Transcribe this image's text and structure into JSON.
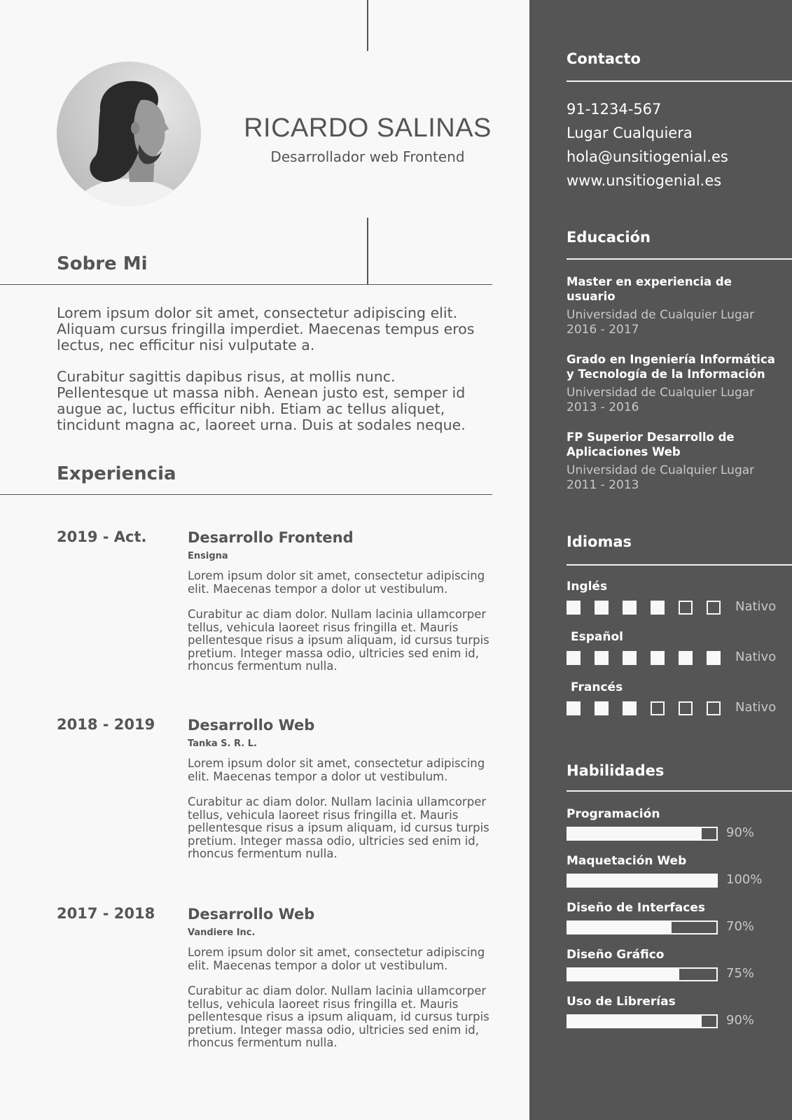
{
  "header": {
    "name": "RICARDO SALINAS",
    "role": "Desarrollador web Frontend"
  },
  "about": {
    "title": "Sobre Mi",
    "paragraphs": [
      "Lorem ipsum dolor sit amet, consectetur adipiscing elit. Aliquam cursus fringilla imperdiet. Maecenas tempus eros lectus, nec efficitur nisi vulputate a.",
      "Curabitur sagittis dapibus risus, at mollis nunc. Pellentesque ut massa nibh. Aenean justo est, semper id augue ac, luctus efficitur nibh. Etiam ac tellus aliquet, tincidunt magna ac, laoreet urna. Duis at sodales neque."
    ]
  },
  "experience": {
    "title": "Experiencia",
    "items": [
      {
        "date": "2019 - Act.",
        "title": "Desarrollo Frontend",
        "company": "Ensigna",
        "text1": "Lorem ipsum dolor sit amet, consectetur adipiscing elit. Maecenas tempor a dolor ut vestibulum.",
        "text2": "Curabitur ac diam dolor. Nullam lacinia ullamcorper tellus, vehicula laoreet risus fringilla et. Mauris pellentesque risus a ipsum aliquam, id cursus turpis pretium. Integer massa odio, ultricies sed enim id, rhoncus fermentum nulla."
      },
      {
        "date": "2018 - 2019",
        "title": "Desarrollo Web",
        "company": "Tanka S. R. L.",
        "text1": "Lorem ipsum dolor sit amet, consectetur adipiscing elit. Maecenas tempor a dolor ut vestibulum.",
        "text2": "Curabitur ac diam dolor. Nullam lacinia ullamcorper tellus, vehicula laoreet risus fringilla et. Mauris pellentesque risus a ipsum aliquam, id cursus turpis pretium. Integer massa odio, ultricies sed enim id, rhoncus fermentum nulla."
      },
      {
        "date": "2017 - 2018",
        "title": "Desarrollo Web",
        "company": "Vandiere Inc.",
        "text1": "Lorem ipsum dolor sit amet, consectetur adipiscing elit. Maecenas tempor a dolor ut vestibulum.",
        "text2": "Curabitur ac diam dolor. Nullam lacinia ullamcorper tellus, vehicula laoreet risus fringilla et. Mauris pellentesque risus a ipsum aliquam, id cursus turpis pretium. Integer massa odio, ultricies sed enim id, rhoncus fermentum nulla."
      }
    ]
  },
  "contact": {
    "title": "Contacto",
    "phone": "91-1234-567",
    "location": "Lugar Cualquiera",
    "email": "hola@unsitiogenial.es",
    "website": "www.unsitiogenial.es"
  },
  "education": {
    "title": "Educación",
    "items": [
      {
        "degree": "Master en experiencia de usuario",
        "school": "Universidad de Cualquier Lugar",
        "years": "2016 - 2017"
      },
      {
        "degree": "Grado en Ingeniería Informática y Tecnología de la Información",
        "school": "Universidad de Cualquier Lugar",
        "years": "2013 - 2016"
      },
      {
        "degree": "FP Superior Desarrollo de Aplicaciones Web",
        "school": "Universidad de Cualquier Lugar",
        "years": "2011 - 2013"
      }
    ]
  },
  "languages": {
    "title": "Idiomas",
    "max_level": 6,
    "items": [
      {
        "name": "Inglés",
        "level": 4,
        "label": "Nativo"
      },
      {
        "name": "Español",
        "level": 6,
        "label": "Nativo"
      },
      {
        "name": "Francés",
        "level": 3,
        "label": "Nativo"
      }
    ]
  },
  "skills": {
    "title": "Habilidades",
    "items": [
      {
        "name": "Programación",
        "percent": 90,
        "label": "90%"
      },
      {
        "name": "Maquetación Web",
        "percent": 100,
        "label": "100%"
      },
      {
        "name": "Diseño de Interfaces",
        "percent": 70,
        "label": "70%"
      },
      {
        "name": "Diseño Gráfico",
        "percent": 75,
        "label": "75%"
      },
      {
        "name": "Uso de Librerías",
        "percent": 90,
        "label": "90%"
      }
    ]
  },
  "colors": {
    "sidebar": "#555555",
    "background": "#f8f8f8",
    "text": "#555555",
    "muted": "#c8c8c8"
  }
}
